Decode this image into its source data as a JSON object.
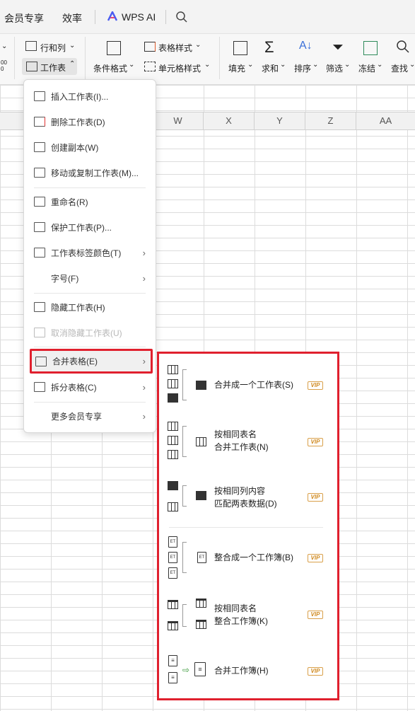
{
  "topbar": {
    "items": [
      "会员专享",
      "效率",
      "WPS AI"
    ],
    "search_icon": "search-icon"
  },
  "ribbon": {
    "row_col": "行和列",
    "worksheet": "工作表",
    "cond_format": "条件格式",
    "table_style": "表格样式",
    "cell_style": "单元格样式",
    "fill": "填充",
    "sum": "求和",
    "sort": "排序",
    "filter": "筛选",
    "freeze": "冻结",
    "find": "查找",
    "left_top": "00",
    "left_bot": "0"
  },
  "columns": [
    "W",
    "X",
    "Y",
    "Z",
    "AA"
  ],
  "menu": {
    "items": [
      {
        "label": "插入工作表(I)...",
        "icon": "insert-sheet-icon"
      },
      {
        "label": "删除工作表(D)",
        "icon": "delete-sheet-icon"
      },
      {
        "label": "创建副本(W)",
        "icon": "copy-sheet-icon"
      },
      {
        "label": "移动或复制工作表(M)...",
        "icon": "move-sheet-icon"
      },
      {
        "label": "重命名(R)",
        "icon": "rename-icon"
      },
      {
        "label": "保护工作表(P)...",
        "icon": "protect-sheet-icon"
      },
      {
        "label": "工作表标签颜色(T)",
        "icon": "tab-color-icon"
      },
      {
        "label": "字号(F)",
        "icon": ""
      },
      {
        "label": "隐藏工作表(H)",
        "icon": "hide-sheet-icon"
      },
      {
        "label": "取消隐藏工作表(U)",
        "icon": "unhide-sheet-icon"
      },
      {
        "label": "合并表格(E)",
        "icon": "merge-tables-icon"
      },
      {
        "label": "拆分表格(C)",
        "icon": "split-table-icon"
      },
      {
        "label": "更多会员专享",
        "icon": ""
      }
    ]
  },
  "submenu": {
    "vip": "VIP",
    "items": [
      {
        "line1": "合并成一个工作表(S)",
        "line2": ""
      },
      {
        "line1": "按相同表名",
        "line2": "合并工作表(N)"
      },
      {
        "line1": "按相同列内容",
        "line2": "匹配两表数据(D)"
      },
      {
        "line1": "整合成一个工作簿(B)",
        "line2": ""
      },
      {
        "line1": "按相同表名",
        "line2": "整合工作簿(K)"
      },
      {
        "line1": "合并工作簿(H)",
        "line2": ""
      }
    ]
  }
}
